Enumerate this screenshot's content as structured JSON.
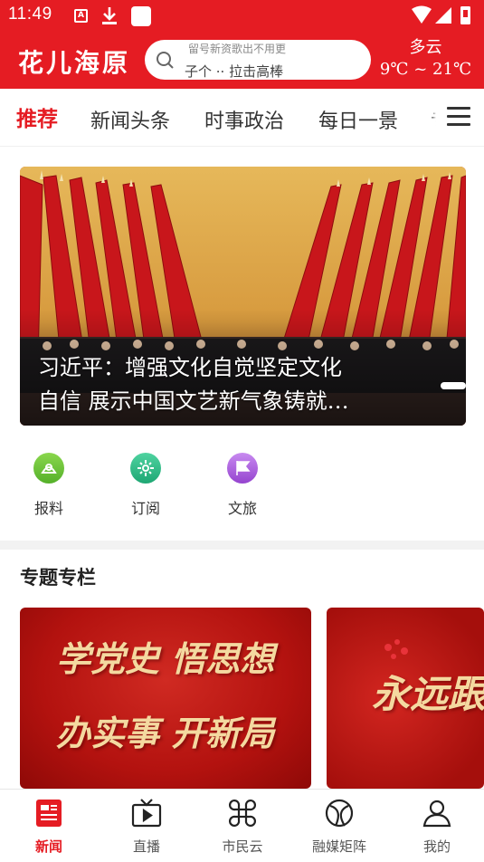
{
  "status_bar": {
    "time": "11:49",
    "icons": [
      "a-notification-icon",
      "download-icon",
      "app-square-icon",
      "wifi-icon",
      "signal-icon",
      "battery-icon"
    ]
  },
  "header": {
    "app_title": "花儿海原",
    "search": {
      "line1": "留号新资歌出不用更",
      "line2": "子个 ·· 拉击高棒",
      "icon": "search-icon"
    },
    "weather": {
      "condition": "多云",
      "temperature": "9℃ ~ 21℃"
    }
  },
  "tabs": [
    {
      "label": "推荐",
      "active": true
    },
    {
      "label": "新闻头条",
      "active": false
    },
    {
      "label": "时事政治",
      "active": false
    },
    {
      "label": "每日一景",
      "active": false
    },
    {
      "label": "专",
      "active": false
    }
  ],
  "banner": {
    "caption_line1": "习近平：增强文化自觉坚定文化",
    "caption_line2": "自信 展示中国文艺新气象铸就…"
  },
  "quick_entries": [
    {
      "label": "报料",
      "icon": "report-icon",
      "color": "#6cc13b"
    },
    {
      "label": "订阅",
      "icon": "subscribe-icon",
      "color": "#2fbf8a"
    },
    {
      "label": "文旅",
      "icon": "travel-flag-icon",
      "color": "#a35cd8"
    }
  ],
  "special_section": {
    "title": "专题专栏",
    "cards": [
      {
        "line1": "学党史 悟思想",
        "line2": "办实事 开新局"
      },
      {
        "line1": "永远跟"
      }
    ]
  },
  "bottom_nav": [
    {
      "label": "新闻",
      "icon": "news-icon",
      "active": true
    },
    {
      "label": "直播",
      "icon": "live-tv-icon",
      "active": false
    },
    {
      "label": "市民云",
      "icon": "citizen-cloud-icon",
      "active": false
    },
    {
      "label": "融媒矩阵",
      "icon": "media-matrix-icon",
      "active": false
    },
    {
      "label": "我的",
      "icon": "profile-icon",
      "active": false
    }
  ],
  "colors": {
    "brand_red": "#e51c23",
    "active_tab": "#e51c23"
  }
}
